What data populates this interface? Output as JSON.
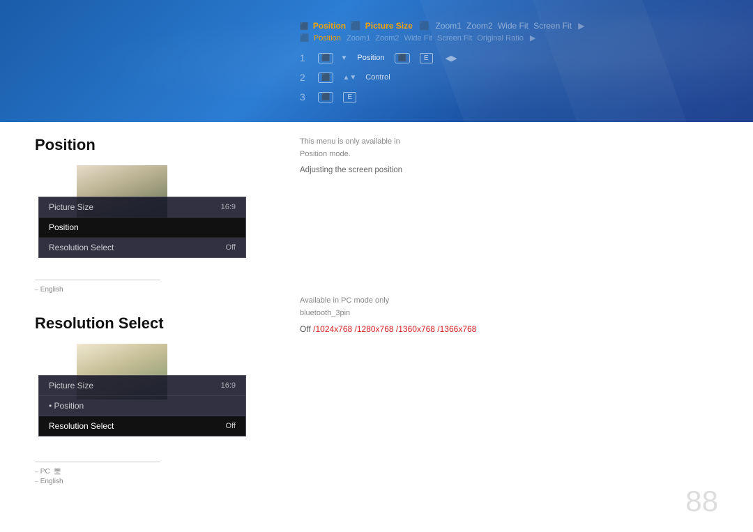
{
  "page": {
    "number": "88"
  },
  "banner": {
    "nav_row1": {
      "items": [
        {
          "label": "Position",
          "state": "active"
        },
        {
          "label": "Picture Size",
          "state": "active-orange"
        },
        {
          "label": "Zoom1",
          "state": "dim"
        },
        {
          "label": "Zoom2",
          "state": "dim"
        },
        {
          "label": "Wide Fit",
          "state": "dim"
        },
        {
          "label": "Screen Fit",
          "state": "dim"
        }
      ]
    },
    "nav_row2": {
      "items": [
        {
          "label": "Position",
          "state": "sub-active"
        },
        {
          "label": "Zoom1",
          "state": "dim"
        },
        {
          "label": "Zoom2",
          "state": "dim"
        },
        {
          "label": "Wide Fit",
          "state": "dim"
        },
        {
          "label": "Screen Fit",
          "state": "dim"
        },
        {
          "label": "Original Ratio",
          "state": "dim"
        }
      ]
    },
    "steps": [
      {
        "num": "1",
        "controls": [
          {
            "type": "icon-remote"
          },
          {
            "type": "triangle-down"
          },
          {
            "type": "text",
            "value": "Position"
          },
          {
            "type": "icon-remote"
          },
          {
            "type": "icon-enter",
            "value": "E"
          }
        ]
      },
      {
        "num": "2",
        "controls": [
          {
            "type": "icon-remote"
          },
          {
            "type": "triangle-up"
          },
          {
            "type": "triangle-down"
          },
          {
            "type": "text",
            "value": "Control"
          }
        ]
      },
      {
        "num": "3",
        "controls": [
          {
            "type": "icon-remote"
          },
          {
            "type": "icon-enter",
            "value": "E"
          }
        ]
      }
    ]
  },
  "position_section": {
    "title": "Position",
    "menu": {
      "items": [
        {
          "label": "Picture Size",
          "value": "16:9",
          "selected": false
        },
        {
          "label": "Position",
          "value": "",
          "selected": true
        },
        {
          "label": "Resolution Select",
          "value": "Off",
          "selected": false
        }
      ]
    },
    "footnotes": [
      {
        "text": "English"
      }
    ]
  },
  "resolution_section": {
    "title": "Resolution Select",
    "menu": {
      "items": [
        {
          "label": "Picture Size",
          "value": "16:9",
          "selected": false
        },
        {
          "label": "• Position",
          "value": "",
          "selected": false
        },
        {
          "label": "Resolution Select",
          "value": "Off",
          "selected": true
        }
      ]
    },
    "footnotes": [
      {
        "text": "PC "
      },
      {
        "text": "English"
      }
    ]
  },
  "position_info": {
    "subtitle1": "This menu is only available in",
    "subtitle2": "Position mode.",
    "steps_label": "Adjusting the screen position"
  },
  "resolution_info": {
    "subtitle1": "Available in PC mode only",
    "subtitle2": "bluetooth_3pin",
    "options_label": "Off /1024x768 /1280x768 /1360x768 /1366x768",
    "off_text": "Off",
    "highlight_text": "/1024x768 /1280x768 /1360x768 /1366x768"
  }
}
